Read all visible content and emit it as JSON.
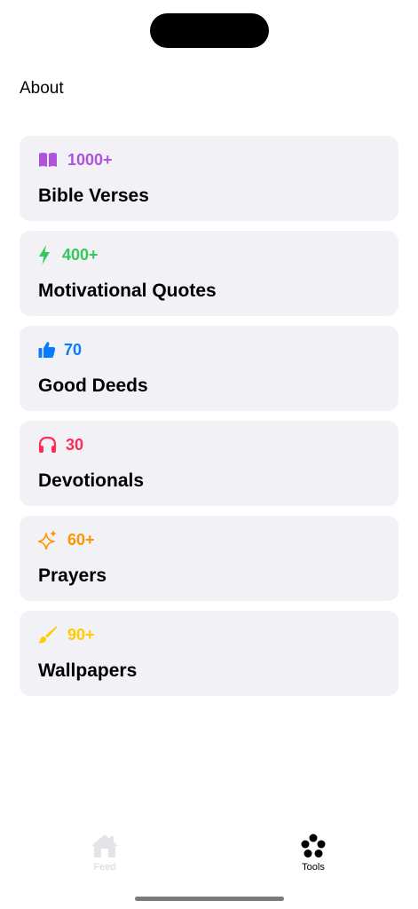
{
  "header": {
    "about_label": "About"
  },
  "cards": [
    {
      "count": "1000+",
      "title": "Bible Verses",
      "icon": "book-icon",
      "color": "#af52de"
    },
    {
      "count": "400+",
      "title": "Motivational Quotes",
      "icon": "bolt-icon",
      "color": "#34c759"
    },
    {
      "count": "70",
      "title": "Good Deeds",
      "icon": "thumbs-up-icon",
      "color": "#0a7aff"
    },
    {
      "count": "30",
      "title": "Devotionals",
      "icon": "headphones-icon",
      "color": "#ff2d55"
    },
    {
      "count": "60+",
      "title": "Prayers",
      "icon": "sparkles-icon",
      "color": "#ff9500"
    },
    {
      "count": "90+",
      "title": "Wallpapers",
      "icon": "paintbrush-icon",
      "color": "#ffcc00"
    }
  ],
  "tabbar": {
    "feed_label": "Feed",
    "tools_label": "Tools",
    "selected": "Tools"
  }
}
